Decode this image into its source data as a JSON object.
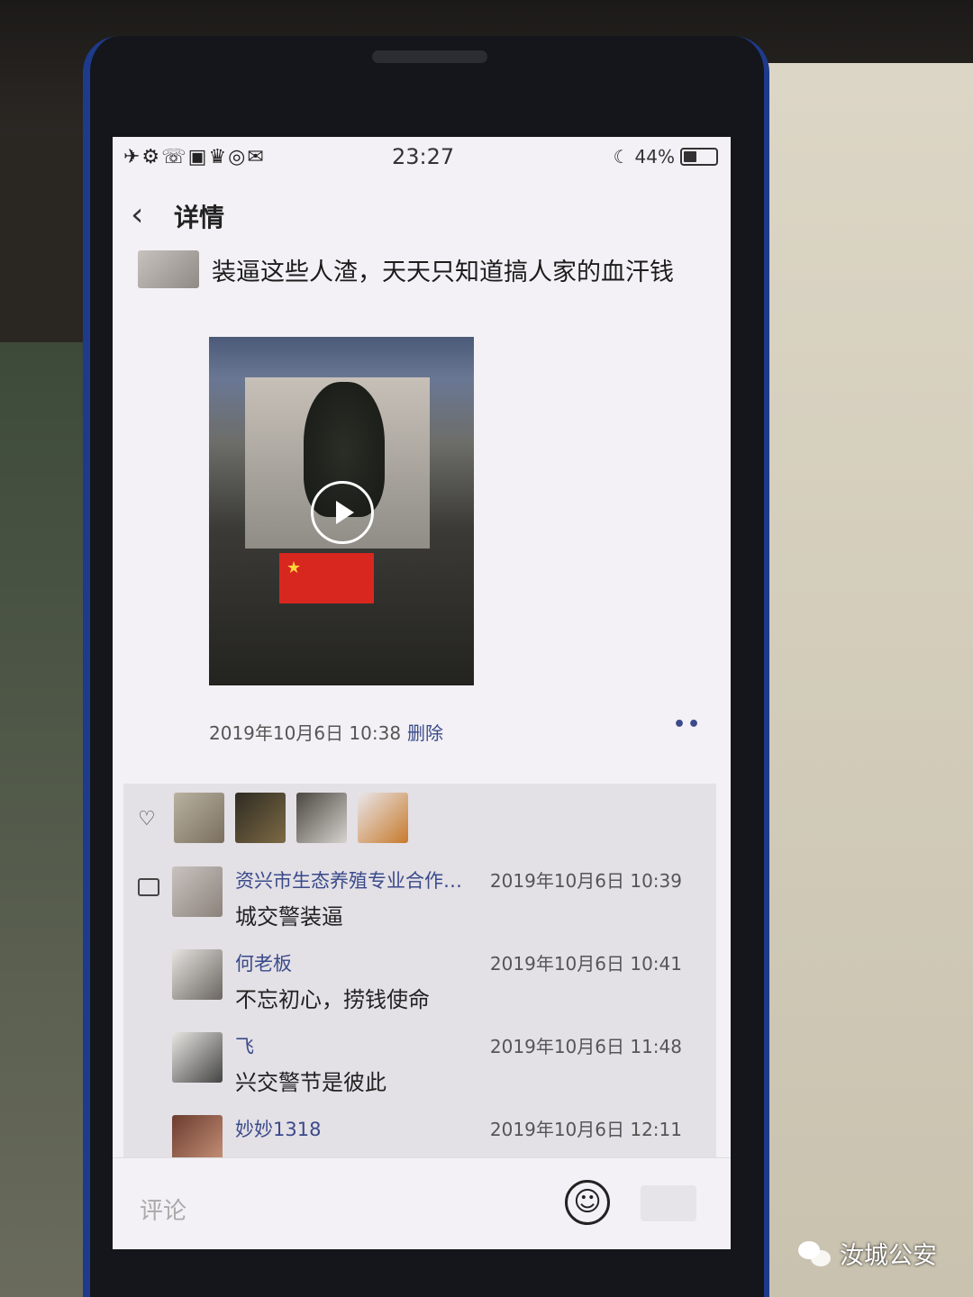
{
  "status_bar": {
    "time": "23:27",
    "battery": "44%",
    "icons": "✈⚙☏▣♛◎✉"
  },
  "nav": {
    "back_icon": "‹",
    "title": "详情"
  },
  "post": {
    "text": "装逼这些人渣，天天只知道搞人家的血汗钱",
    "time": "2019年10月6日 10:38",
    "delete_label": "删除",
    "more_icon": "••"
  },
  "likes": {
    "count_shown": 4
  },
  "comments": [
    {
      "name": "资兴市生态养殖专业合作…",
      "time": "2019年10月6日 10:39",
      "text": "城交警装逼"
    },
    {
      "name": "何老板",
      "time": "2019年10月6日 10:41",
      "text": "不忘初心，捞钱使命"
    },
    {
      "name": "飞",
      "time": "2019年10月6日 11:48",
      "text": "兴交警节是彼此"
    },
    {
      "name": "妙妙1318",
      "time": "2019年10月6日 12:11",
      "text": ""
    }
  ],
  "input": {
    "placeholder": "评论",
    "emoji_icon": "☺"
  },
  "watermark": {
    "text": "汝城公安"
  },
  "colors": {
    "link_blue": "#3a4a8a",
    "phone_edge": "#1e3a8a",
    "flag_red": "#d8271f"
  }
}
